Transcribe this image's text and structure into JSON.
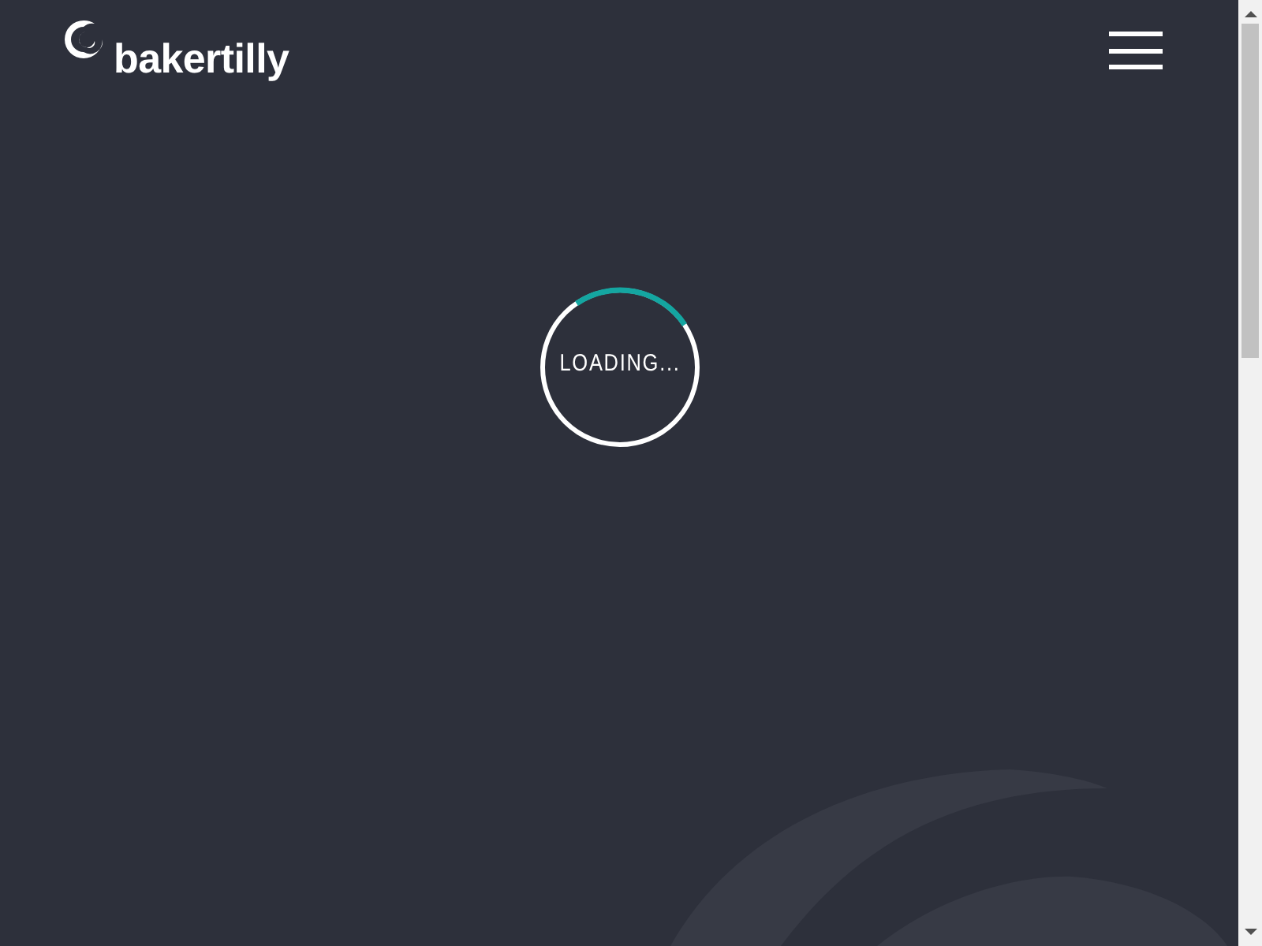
{
  "header": {
    "logo_text": "bakertilly"
  },
  "loader": {
    "text": "LOADING..."
  }
}
